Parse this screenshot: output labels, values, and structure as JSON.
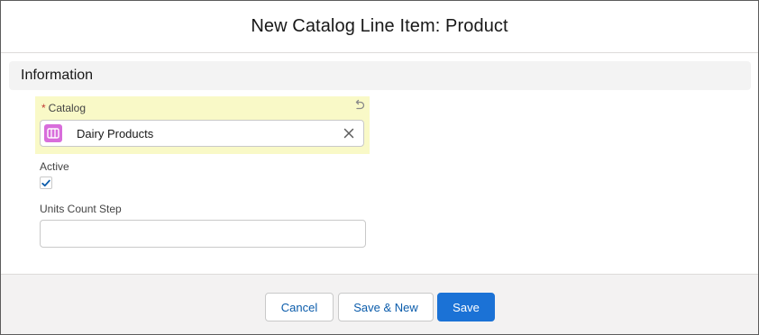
{
  "modal": {
    "title": "New Catalog Line Item: Product"
  },
  "section": {
    "title": "Information"
  },
  "fields": {
    "catalog": {
      "required_marker": "*",
      "label": "Catalog",
      "value": "Dairy Products",
      "icon": "catalog-icon",
      "highlight_color": "#f9f9c7"
    },
    "active": {
      "label": "Active",
      "checked": true
    },
    "units_count_step": {
      "label": "Units Count Step",
      "value": ""
    }
  },
  "footer": {
    "cancel_label": "Cancel",
    "save_new_label": "Save & New",
    "save_label": "Save"
  },
  "colors": {
    "brand": "#1b72d6",
    "link": "#0b5cab",
    "catalog_icon_bg": "#d86ddb",
    "required": "#c23934"
  }
}
